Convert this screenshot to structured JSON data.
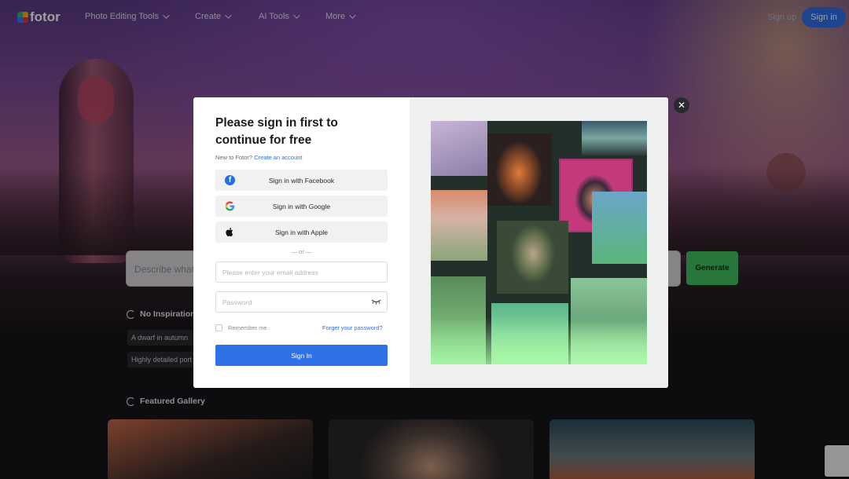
{
  "nav": {
    "brand": "fotor",
    "menu": [
      "Photo Editing Tools",
      "Create",
      "AI Tools",
      "More"
    ],
    "signup_label": "Sign up",
    "signin_label": "Sign in"
  },
  "generator": {
    "prompt_placeholder": "Describe what",
    "generate_label": "Generate",
    "inspiration_label": "No Inspiration",
    "chips": [
      "A dwarf in autumn",
      "Highly detailed port"
    ],
    "featured_label": "Featured Gallery"
  },
  "modal": {
    "title": "Please sign in first to continue for free",
    "new_prompt": "New to Fotor?",
    "create_account": "Create an account",
    "facebook_label": "Sign in with Facebook",
    "google_label": "Sign in with Google",
    "apple_label": "Sign in with Apple",
    "or_text": "— or —",
    "email_placeholder": "Please enter your email address",
    "password_placeholder": "Password",
    "remember_label": "Remember me",
    "forgot_label": "Forget your password?",
    "submit_label": "Sign In",
    "close_symbol": "✕"
  },
  "colors": {
    "accent": "#2f72e8",
    "generate": "#3fbf5f"
  }
}
